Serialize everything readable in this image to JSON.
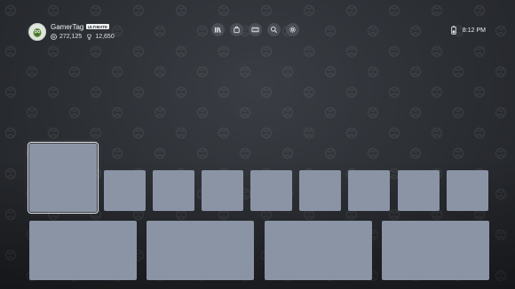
{
  "profile": {
    "gamertag": "GamerTag",
    "badge": "ULTIMATE",
    "gamerscore": "272,125",
    "rewards_points": "12,650",
    "avatar_icon": "avatar-icon"
  },
  "toolbar": {
    "buttons": [
      {
        "name": "library-button",
        "icon": "library-icon"
      },
      {
        "name": "store-button",
        "icon": "store-icon"
      },
      {
        "name": "guide-button",
        "icon": "guide-icon"
      },
      {
        "name": "search-button",
        "icon": "search-icon"
      },
      {
        "name": "settings-button",
        "icon": "gear-icon"
      }
    ]
  },
  "status": {
    "time": "8:12 PM",
    "controller_icon": "controller-battery-icon"
  },
  "tiles": {
    "row1_count": 9,
    "row2_count": 4
  },
  "colors": {
    "tile": "#8a94a5",
    "background": "#2b2e33",
    "focus_outline": "#dfe4ea"
  }
}
